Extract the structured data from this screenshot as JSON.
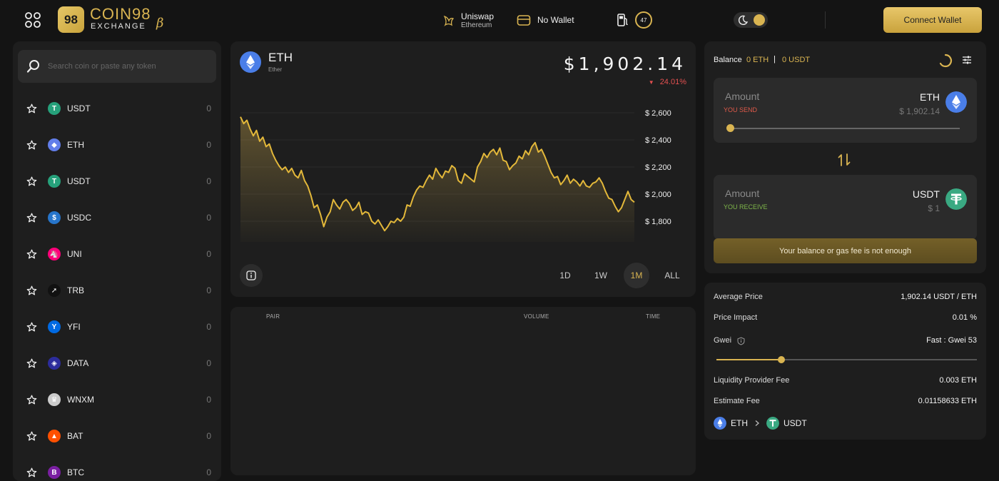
{
  "header": {
    "logo_mark": "98",
    "logo_text": "COIN98",
    "logo_subtext": "EXCHANGE",
    "beta_mark": "β",
    "dex_name": "Uniswap",
    "dex_chain": "Ethereum",
    "wallet_label": "No Wallet",
    "gas_value": "47",
    "connect_label": "Connect Wallet"
  },
  "search": {
    "placeholder": "Search coin or paste any token"
  },
  "tokens": [
    {
      "symbol": "USDT",
      "balance": "0",
      "color": "#26a17b",
      "glyph": "T"
    },
    {
      "symbol": "ETH",
      "balance": "0",
      "color": "#627eea",
      "glyph": "◆"
    },
    {
      "symbol": "USDT",
      "balance": "0",
      "color": "#26a17b",
      "glyph": "T"
    },
    {
      "symbol": "USDC",
      "balance": "0",
      "color": "#2775ca",
      "glyph": "$"
    },
    {
      "symbol": "UNI",
      "balance": "0",
      "color": "#ff007a",
      "glyph": "🦄"
    },
    {
      "symbol": "TRB",
      "balance": "0",
      "color": "#111111",
      "glyph": "➚"
    },
    {
      "symbol": "YFI",
      "balance": "0",
      "color": "#006ae3",
      "glyph": "Y"
    },
    {
      "symbol": "DATA",
      "balance": "0",
      "color": "#2c2c9c",
      "glyph": "◈"
    },
    {
      "symbol": "WNXM",
      "balance": "0",
      "color": "#cccccc",
      "glyph": "♛"
    },
    {
      "symbol": "BAT",
      "balance": "0",
      "color": "#ff5000",
      "glyph": "▲"
    },
    {
      "symbol": "BTC",
      "balance": "0",
      "color": "#7a1fa2",
      "glyph": "B"
    }
  ],
  "coin": {
    "symbol": "ETH",
    "name": "Ether",
    "price": "$1,902.14",
    "change": "24.01%"
  },
  "chart_data": {
    "type": "area",
    "title": "",
    "xlabel": "",
    "ylabel": "",
    "ylim": [
      1700,
      2700
    ],
    "yticks": [
      "$ 2,600",
      "$ 2,400",
      "$ 2,200",
      "$ 2,000",
      "$ 1,800"
    ],
    "ytick_values": [
      2600,
      2400,
      2200,
      2000,
      1800
    ],
    "range": "1M",
    "values": [
      2570,
      2520,
      2545,
      2480,
      2430,
      2470,
      2390,
      2420,
      2350,
      2370,
      2300,
      2250,
      2210,
      2180,
      2200,
      2160,
      2190,
      2140,
      2120,
      2175,
      2100,
      2060,
      1990,
      1900,
      1920,
      1850,
      1760,
      1830,
      1870,
      1960,
      1920,
      1890,
      1940,
      1960,
      1930,
      1880,
      1900,
      1940,
      1850,
      1870,
      1860,
      1800,
      1780,
      1810,
      1770,
      1730,
      1760,
      1800,
      1790,
      1820,
      1800,
      1830,
      1920,
      1910,
      1980,
      2030,
      2060,
      2050,
      2100,
      2140,
      2110,
      2190,
      2150,
      2120,
      2170,
      2160,
      2210,
      2190,
      2100,
      2080,
      2150,
      2130,
      2110,
      2090,
      2200,
      2240,
      2300,
      2270,
      2310,
      2330,
      2290,
      2340,
      2250,
      2240,
      2180,
      2210,
      2230,
      2280,
      2260,
      2320,
      2290,
      2350,
      2380,
      2310,
      2330,
      2280,
      2220,
      2160,
      2120,
      2130,
      2070,
      2100,
      2140,
      2080,
      2110,
      2090,
      2060,
      2100,
      2060,
      2050,
      2080,
      2090,
      2120,
      2080,
      2020,
      1970,
      1960,
      1910,
      1870,
      1900,
      1960,
      2020,
      1960,
      1940
    ],
    "range_options": [
      "1D",
      "1W",
      "1M",
      "ALL"
    ]
  },
  "trades": {
    "col_pair": "PAIR",
    "col_volume": "VOLUME",
    "col_time": "TIME"
  },
  "swap": {
    "balance_label": "Balance",
    "balance_eth": "0 ETH",
    "separator": "|",
    "balance_usdt": "0 USDT",
    "send_placeholder": "Amount",
    "send_tag": "YOU SEND",
    "send_symbol": "ETH",
    "send_usd": "$ 1,902.14",
    "receive_placeholder": "Amount",
    "receive_tag": "YOU RECEIVE",
    "receive_symbol": "USDT",
    "receive_usd": "$ 1",
    "warning": "Your balance or gas fee is not enough",
    "colors": {
      "send_tag": "#e05a4a",
      "receive_tag": "#7fb84a",
      "accent": "#d9b451"
    }
  },
  "details": {
    "avg_price_label": "Average Price",
    "avg_price_value": "1,902.14 USDT / ETH",
    "impact_label": "Price Impact",
    "impact_value": "0.01 %",
    "gwei_label": "Gwei",
    "gwei_value": "Fast : Gwei 53",
    "gwei_level": 0.25,
    "lp_fee_label": "Liquidity Provider Fee",
    "lp_fee_value": "0.003 ETH",
    "est_fee_label": "Estimate Fee",
    "est_fee_value": "0.01158633 ETH",
    "route_from": "ETH",
    "route_to": "USDT"
  }
}
